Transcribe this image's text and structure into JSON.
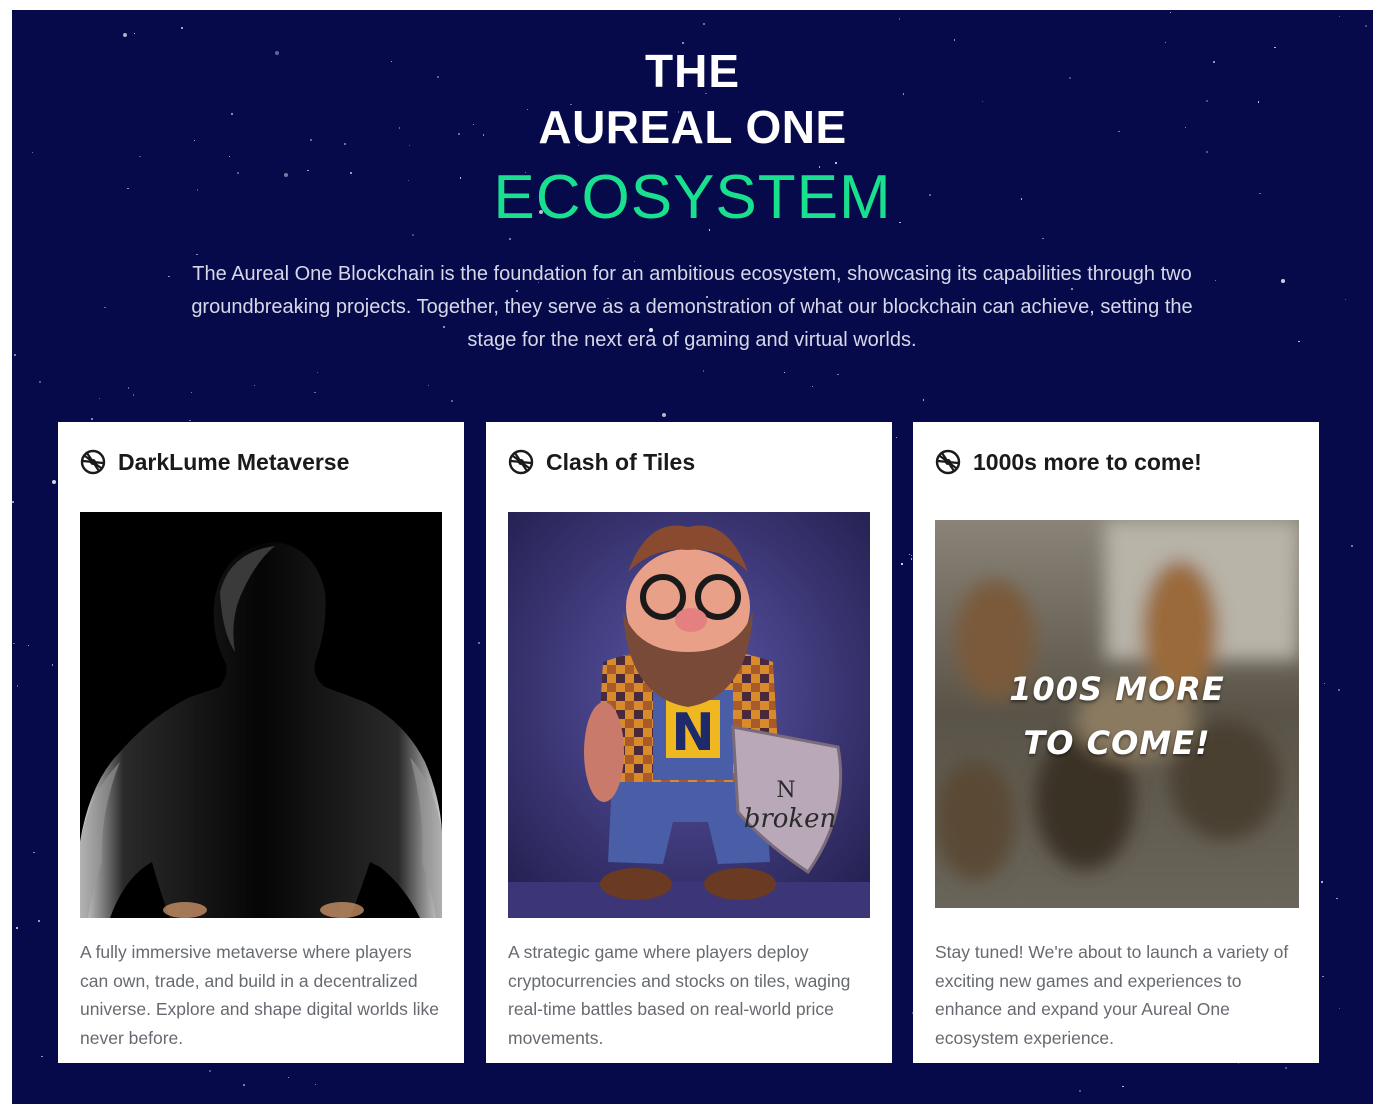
{
  "header": {
    "line1": "THE",
    "line2": "AUREAL ONE",
    "line3": "ECOSYSTEM"
  },
  "intro": "The Aureal One Blockchain is the foundation for an ambitious ecosystem, showcasing its capabilities through two groundbreaking projects. Together, they serve as a demonstration of what our blockchain can achieve, setting the stage for the next era of gaming and virtual worlds.",
  "cards": [
    {
      "title": "DarkLume Metaverse",
      "icon": "ecosystem-logo-icon",
      "image": "silhouette-man-image",
      "text": "A fully immersive metaverse where players can own, trade, and build in a decentralized universe. Explore and shape digital worlds like never before."
    },
    {
      "title": "Clash of Tiles",
      "icon": "ecosystem-logo-icon",
      "image": "dwarf-character-image",
      "image_text_1": "N",
      "image_text_2": "broken",
      "text": "A strategic game where players deploy cryptocurrencies and stocks on tiles, waging real-time battles based on real-world price movements."
    },
    {
      "title": "1000s more to come!",
      "icon": "ecosystem-logo-icon",
      "image": "blurred-figures-image",
      "image_text_1": "100S MORE",
      "image_text_2": "TO COME!",
      "text": "Stay tuned! We're about to launch a variety of exciting new games and experiences to enhance and expand your Aureal One ecosystem experience."
    }
  ],
  "colors": {
    "background": "#060a4a",
    "accent": "#19e08e",
    "card": "#ffffff",
    "body_text": "#666a70"
  }
}
